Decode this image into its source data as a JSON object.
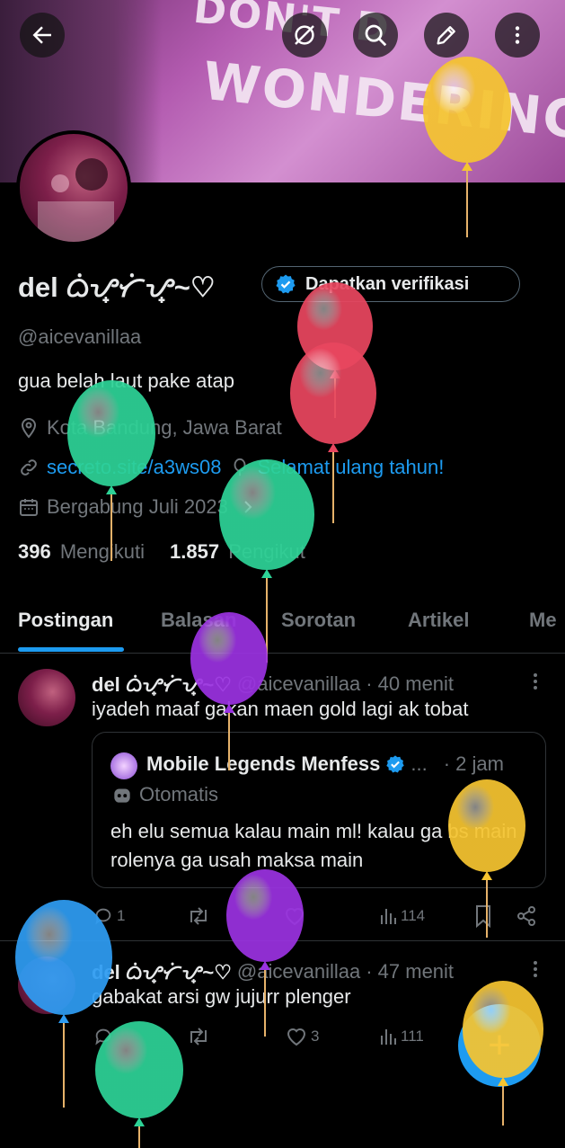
{
  "banner": {
    "text_line1": "DON'T D",
    "text_line2": "WONDERING"
  },
  "profile": {
    "name": "del ᜊᜒᜌ᜔ᜆᜒᜌ᜔~♡",
    "handle": "@aicevanillaa",
    "bio": "gua belah laut pake atap",
    "location": "Kota Bandung, Jawa Barat",
    "link": "secreto.site/a3ws08",
    "birthday": "Selamat ulang tahun!",
    "joined": "Bergabung Juli 2023",
    "following_count": "396",
    "following_label": "Mengikuti",
    "followers_count": "1.857",
    "followers_label": "Pengikut",
    "verify_label": "Dapatkan verifikasi"
  },
  "tabs": [
    "Postingan",
    "Balasan",
    "Sorotan",
    "Artikel",
    "Me"
  ],
  "posts": [
    {
      "name": "del ᜊᜒᜌ᜔ᜆᜒᜌ᜔~♡",
      "handle": "@aicevanillaa",
      "time": "· 40 menit",
      "text": "iyadeh maaf gakan maen gold lagi ak tobat",
      "quote": {
        "name": "Mobile Legends Menfess",
        "ellipsis": "...",
        "time": "· 2 jam",
        "tag": "Otomatis",
        "text": "eh elu semua kalau main ml! kalau ga bs main rolenya ga usah maksa main"
      },
      "replies": "1",
      "likes": "",
      "views": "114"
    },
    {
      "name": "del ᜊᜒᜌ᜔ᜆᜒᜌ᜔~♡",
      "handle": "@aicevanillaa",
      "time": "· 47 menit",
      "text": "gabakat arsi gw jujurr plenger",
      "replies": "",
      "likes": "3",
      "views": "111"
    }
  ],
  "fab": {
    "label": "+"
  },
  "colors": {
    "accent": "#1d9bf0",
    "background": "#000000",
    "muted": "#71767b"
  }
}
